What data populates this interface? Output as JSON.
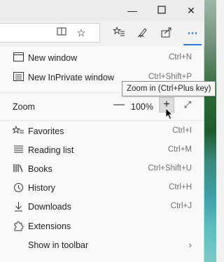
{
  "window": {
    "minimize_icon": "minimize-icon",
    "maximize_icon": "maximize-icon",
    "close_icon": "close-icon"
  },
  "toolbar": {
    "icons": [
      "reading-view-icon",
      "favorite-star-icon",
      "favorites-hub-icon",
      "pen-notes-icon",
      "share-icon",
      "more-icon"
    ]
  },
  "menu": {
    "new_window": {
      "label": "New window",
      "shortcut": "Ctrl+N"
    },
    "new_inprivate": {
      "label": "New InPrivate window",
      "shortcut": "Ctrl+Shift+P"
    },
    "zoom": {
      "label": "Zoom",
      "value": "100%",
      "minus": "—",
      "plus": "+"
    },
    "favorites": {
      "label": "Favorites",
      "shortcut": "Ctrl+I"
    },
    "reading_list": {
      "label": "Reading list",
      "shortcut": "Ctrl+M"
    },
    "books": {
      "label": "Books",
      "shortcut": "Ctrl+Shift+U"
    },
    "history": {
      "label": "History",
      "shortcut": "Ctrl+H"
    },
    "downloads": {
      "label": "Downloads",
      "shortcut": "Ctrl+J"
    },
    "extensions": {
      "label": "Extensions"
    },
    "show_in_toolbar": {
      "label": "Show in toolbar"
    }
  },
  "tooltip": {
    "text": "Zoom in (Ctrl+Plus key)"
  },
  "colors": {
    "accent": "#2b79d8",
    "menu_bg": "#f9f9f9"
  }
}
